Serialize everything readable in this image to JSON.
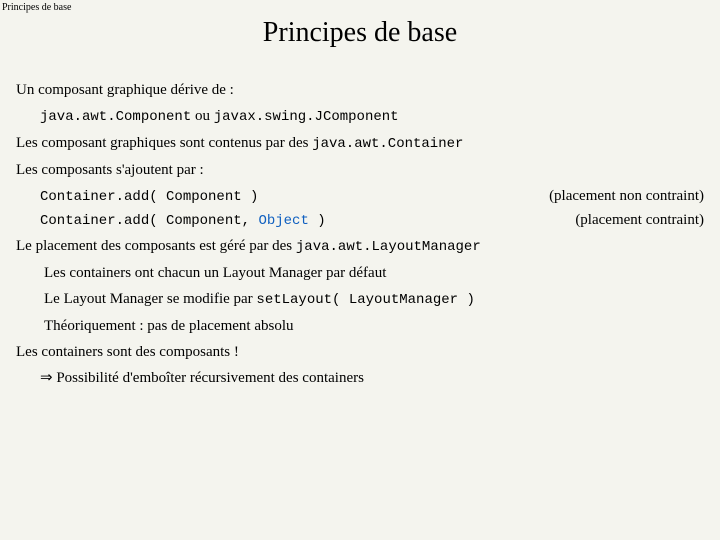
{
  "header_small": "Principes de base",
  "title": "Principes de base",
  "p1": "Un composant graphique dérive de :",
  "p1a_pre": "java.awt.Component",
  "p1a_mid": " ou ",
  "p1a_post": "javax.swing.JComponent",
  "p2a": "Les composant graphiques sont contenus par des ",
  "p2b": "java.awt.Container",
  "p3": "Les composants s'ajoutent par :",
  "p3a_code": "Container.add( Component )",
  "p3a_note": "(placement non contraint)",
  "p3b_code_pre": "Container.add( Component, ",
  "p3b_code_obj": "Object",
  "p3b_code_post": " )",
  "p3b_note": "(placement contraint)",
  "p4a": "Le placement des composants est géré par des ",
  "p4b": "java.awt.LayoutManager",
  "p5": "Les containers ont chacun un Layout Manager par défaut",
  "p6a": "Le Layout Manager se modifie par ",
  "p6b": "setLayout( LayoutManager )",
  "p7": "Théoriquement : pas de placement absolu",
  "p8": "Les containers sont des composants !",
  "p9": "⇒ Possibilité d'emboîter récursivement des containers"
}
